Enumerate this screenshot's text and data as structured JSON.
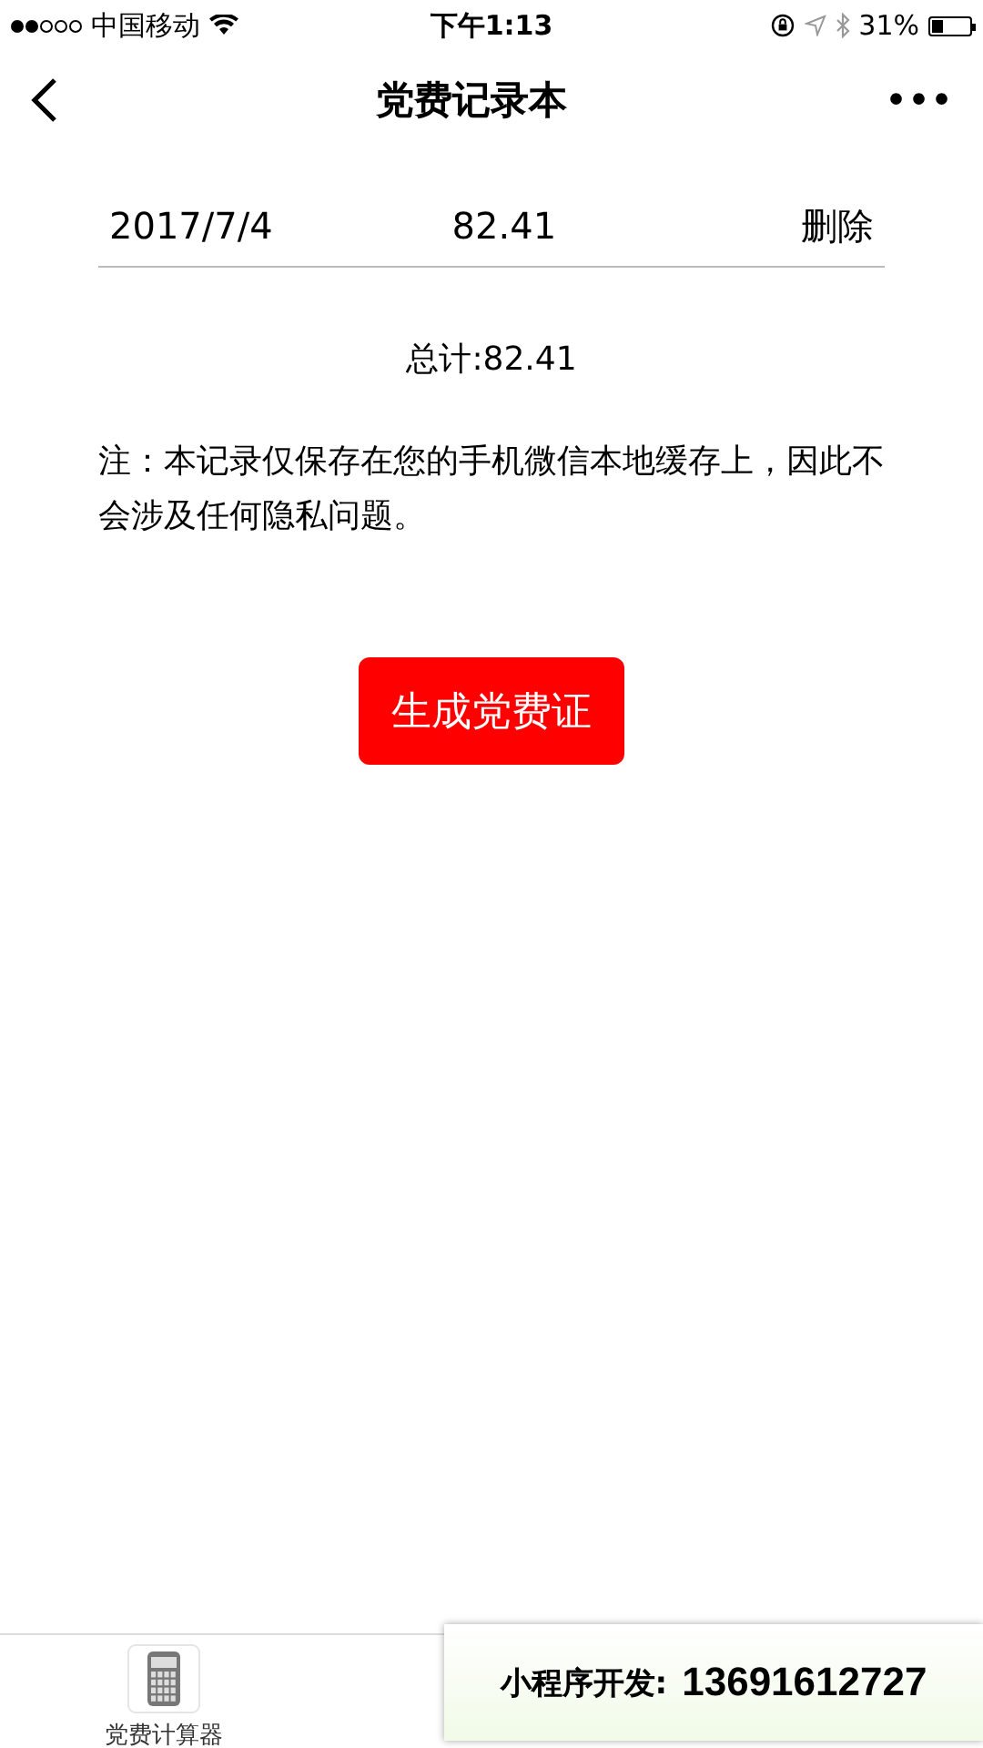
{
  "status_bar": {
    "carrier": "中国移动",
    "time": "下午1:13",
    "battery_text": "31%"
  },
  "nav": {
    "title": "党费记录本",
    "more": "•••"
  },
  "records": [
    {
      "date": "2017/7/4",
      "amount": "82.41",
      "action": "删除"
    }
  ],
  "total": "总计:82.41",
  "note": "注：本记录仅保存在您的手机微信本地缓存上，因此不会涉及任何隐私问题。",
  "button": "生成党费证",
  "tab_bar": {
    "items": [
      {
        "label": "党费计算器",
        "selected": false
      }
    ]
  },
  "overlay": {
    "label": "小程序开发:",
    "phone": "13691612727"
  }
}
